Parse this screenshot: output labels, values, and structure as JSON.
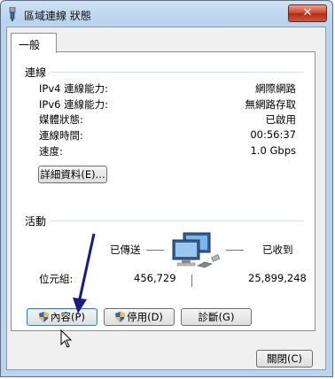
{
  "window": {
    "title": "區域連線 狀態",
    "close_label": "✕"
  },
  "tabs": [
    {
      "label": "一般"
    }
  ],
  "connection": {
    "heading": "連線",
    "rows": [
      {
        "label": "IPv4 連線能力:",
        "value": "網際網路"
      },
      {
        "label": "IPv6 連線能力:",
        "value": "無網路存取"
      },
      {
        "label": "媒體狀態:",
        "value": "已啟用"
      },
      {
        "label": "連線時間:",
        "value": "00:56:37"
      },
      {
        "label": "速度:",
        "value": "1.0 Gbps"
      }
    ],
    "details_button": "詳細資料(E)..."
  },
  "activity": {
    "heading": "活動",
    "sent_label": "已傳送",
    "received_label": "已收到",
    "bytes_label": "位元組:",
    "bytes_sent": "456,729",
    "bytes_received": "25,899,248"
  },
  "buttons": {
    "properties": "內容(P)",
    "disable": "停用(D)",
    "diagnose": "診斷(G)",
    "close": "關閉(C)"
  }
}
